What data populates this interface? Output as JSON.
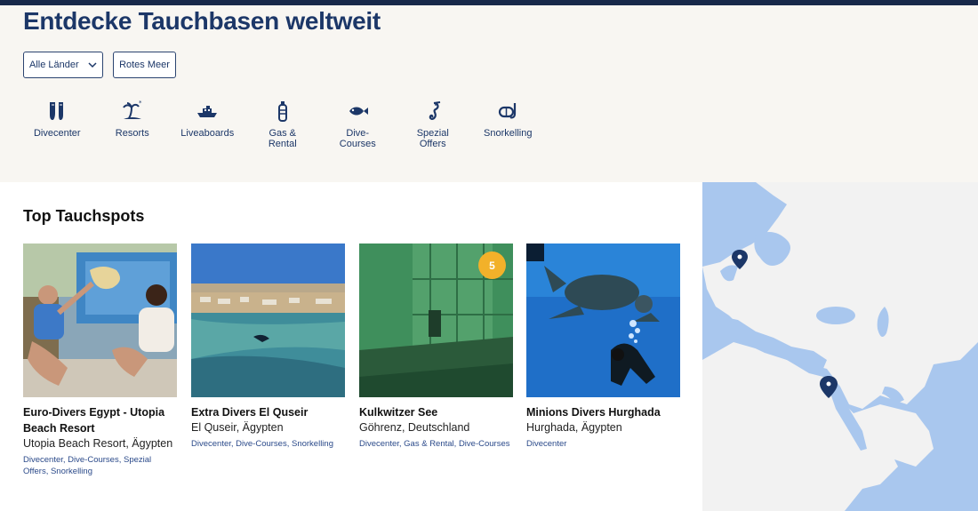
{
  "page": {
    "title": "Entdecke Tauchbasen weltweit"
  },
  "filters": {
    "country": "Alle Länder",
    "region": "Rotes Meer"
  },
  "categories": [
    {
      "label": "Divecenter",
      "icon": "fins-icon"
    },
    {
      "label": "Resorts",
      "icon": "palm-island-icon"
    },
    {
      "label": "Liveaboards",
      "icon": "boat-icon"
    },
    {
      "label": "Gas & Rental",
      "icon": "oxygen-tank-icon"
    },
    {
      "label": "Dive-Courses",
      "icon": "fish-icon"
    },
    {
      "label": "Spezial Offers",
      "icon": "seahorse-icon"
    },
    {
      "label": "Snorkelling",
      "icon": "snorkel-mask-icon"
    }
  ],
  "section": {
    "title": "Top Tauchspots"
  },
  "cards": [
    {
      "name": "Euro-Divers Egypt - Utopia Beach Resort",
      "location": "Utopia Beach Resort, Ägypten",
      "tags": "Divecenter, Dive-Courses, Spezial Offers, Snorkelling"
    },
    {
      "name": "Extra Divers El Quseir",
      "location": "El Quseir, Ägypten",
      "tags": "Divecenter, Dive-Courses, Snorkelling"
    },
    {
      "name": "Kulkwitzer See",
      "location": "Göhrenz, Deutschland",
      "tags": "Divecenter, Gas & Rental, Dive-Courses",
      "badge": "5"
    },
    {
      "name": "Minions Divers Hurghada",
      "location": "Hurghada, Ägypten",
      "tags": "Divecenter"
    }
  ],
  "colors": {
    "brand": "#1c3768",
    "badge": "#f2b12a",
    "map_water": "#a9c7ee",
    "map_land": "#f2f2f2"
  }
}
